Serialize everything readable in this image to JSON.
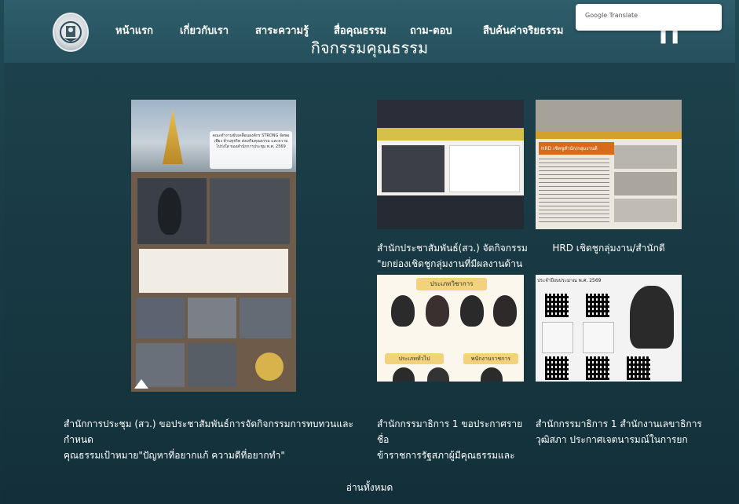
{
  "header": {
    "nav": [
      "หน้าแรก",
      "เกี่ยวกับเรา",
      "สาระความรู้",
      "สื่อคุณธรรม",
      "ถาม-ตอบ",
      "สืบค้นค่าจริยธรรม"
    ],
    "page_title": "กิจกรรมคุณธรรม",
    "google_translate_label": "Google Translate"
  },
  "cards": [
    {
      "caption_line1": "สำนักการประชุม (สว.) ขอประชาสัมพันธ์การจัดกิจกรรมการทบทวนและกำหนด",
      "caption_line2": "คุณธรรมเป้าหมาย\"ปัญหาที่อยากแก้ ความดีที่อยากทำ\""
    },
    {
      "caption_line1": "สำนักประชาสัมพันธ์(สว.) จัดกิจกรรม",
      "caption_line2": "\"ยกย่องเชิดชูกลุ่มงานที่มีผลงานด้าน"
    },
    {
      "caption_line1": "HRD เชิดชูกลุ่มงาน/สำนักดี",
      "caption_line2": ""
    },
    {
      "caption_line1": "สำนักกรรมาธิการ 1 ขอประกาศรายชื่อ",
      "caption_line2": "ข้าราชการรัฐสภาผู้มีคุณธรรมและ"
    },
    {
      "caption_line1": "สำนักกรรมาธิการ 1 สำนักงานเลขาธิการ",
      "caption_line2": "วุฒิสภา ประกาศเจตนารมณ์ในการยก"
    }
  ],
  "poster_texts": {
    "big_heading": "คณะทำงานขับเคลื่อนองค์กร STRONG จัดพอเพียง ต้านทุจริต ส่งเสริมคุณธรรม และความโปร่งใส ของสำนักการประชุม พ.ศ. 2569",
    "c2_heading": "HRD เชิดชูสำนัก/กลุ่มงานดี",
    "c3_heading": "ประเภทวิชาการ",
    "c3_sub1": "ประเภททั่วไป",
    "c3_sub2": "พนักงานราชการ",
    "c4_heading": "ประจำปีงบประมาณ พ.ศ. 2569"
  },
  "read_all": "อ่านทั้งหมด",
  "colors": {
    "background": "#173741",
    "header": "#2a5662",
    "text": "#ffffff"
  }
}
